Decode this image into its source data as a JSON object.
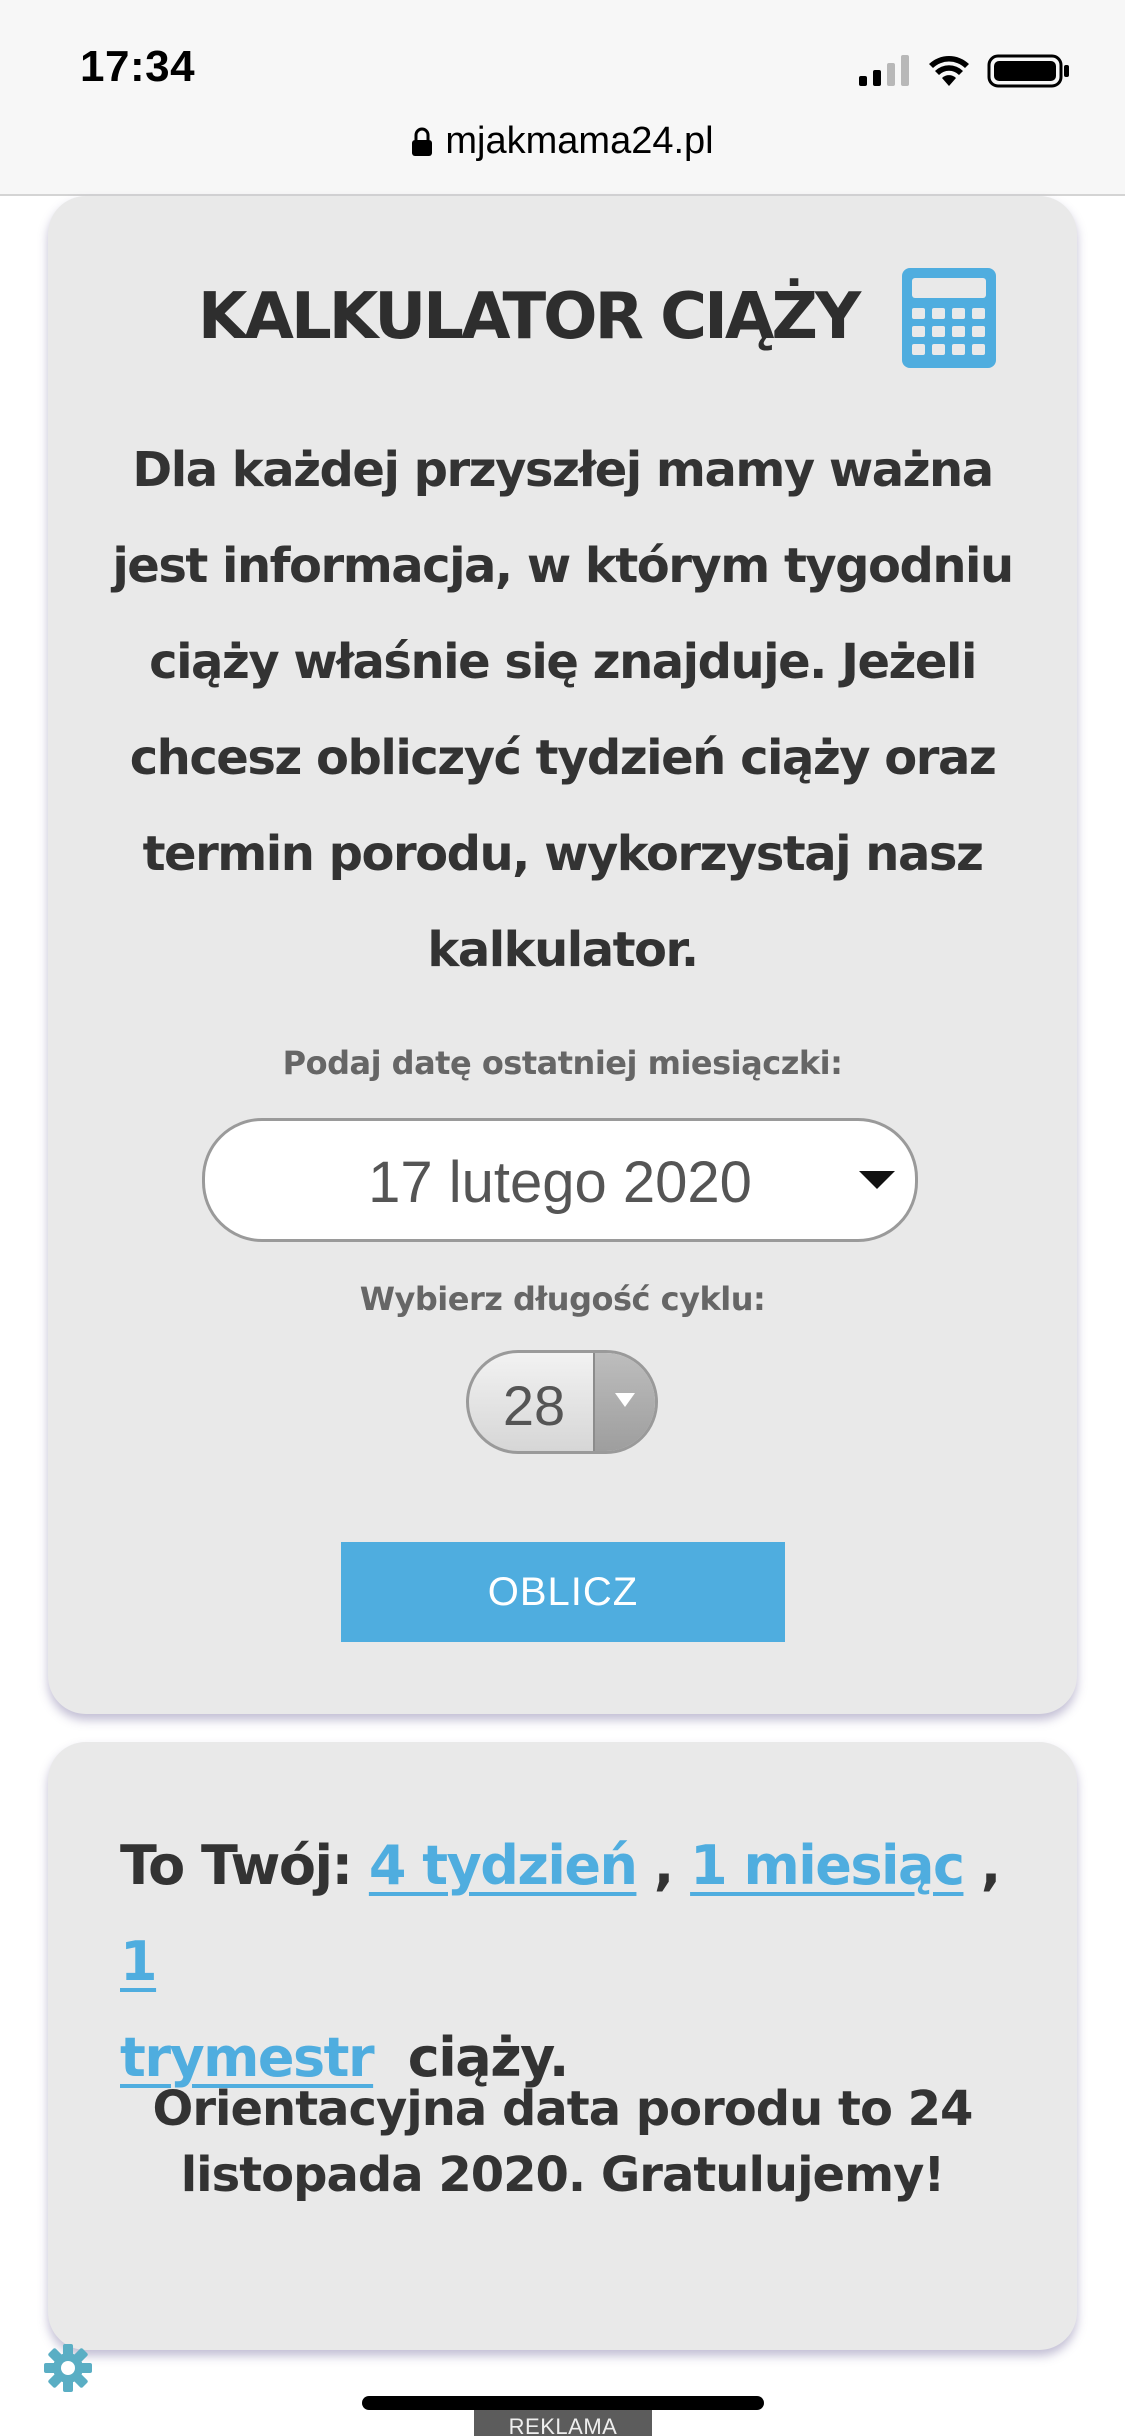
{
  "status_bar": {
    "time": "17:34",
    "icons": [
      "signal-icon",
      "wifi-icon",
      "battery-icon"
    ]
  },
  "browser": {
    "url": "mjakmama24.pl",
    "lock_icon": "lock-icon"
  },
  "calculator": {
    "title": "KALKULATOR CIĄŻY",
    "icon": "calculator-icon",
    "intro_lines": [
      "Dla każdej przyszłej mamy ważna",
      "jest informacja, w którym tygodniu",
      "ciąży właśnie się znajduje. Jeżeli",
      "chcesz obliczyć tydzień ciąży oraz",
      "termin porodu, wykorzystaj nasz",
      "kalkulator."
    ],
    "date_label": "Podaj datę ostatniej miesiączki:",
    "date_value": "17 lutego 2020",
    "cycle_label": "Wybierz długość cyklu:",
    "cycle_value": "28",
    "button_label": "OBLICZ"
  },
  "result": {
    "prefix": "To Twój:",
    "week_link": "4 tydzień",
    "separator": ",",
    "month_link": "1 miesiąc",
    "trimester_link_part1": "1",
    "trimester_link_part2": "trymestr",
    "suffix": "ciąży.",
    "due_date_line1": "Orientacyjna data porodu to 24",
    "due_date_line2": "listopada 2020. Gratulujemy!"
  },
  "colors": {
    "accent": "#4faddf",
    "card_background": "#e9e9e9",
    "text": "#333333"
  },
  "footer": {
    "settings_icon": "gear-icon",
    "ad_label": "REKLAMA"
  }
}
